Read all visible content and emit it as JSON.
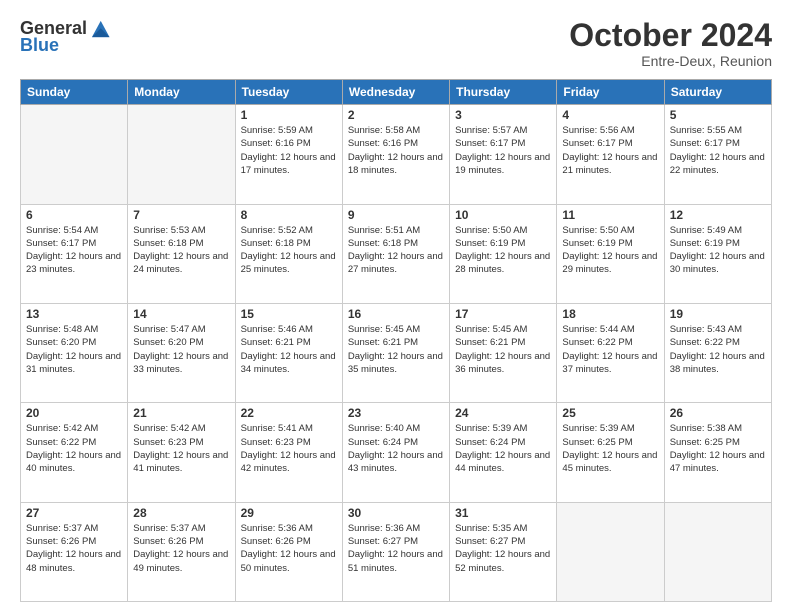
{
  "logo": {
    "line1": "General",
    "line2": "Blue"
  },
  "title": "October 2024",
  "location": "Entre-Deux, Reunion",
  "days_of_week": [
    "Sunday",
    "Monday",
    "Tuesday",
    "Wednesday",
    "Thursday",
    "Friday",
    "Saturday"
  ],
  "weeks": [
    [
      {
        "day": "",
        "info": ""
      },
      {
        "day": "",
        "info": ""
      },
      {
        "day": "1",
        "info": "Sunrise: 5:59 AM\nSunset: 6:16 PM\nDaylight: 12 hours and 17 minutes."
      },
      {
        "day": "2",
        "info": "Sunrise: 5:58 AM\nSunset: 6:16 PM\nDaylight: 12 hours and 18 minutes."
      },
      {
        "day": "3",
        "info": "Sunrise: 5:57 AM\nSunset: 6:17 PM\nDaylight: 12 hours and 19 minutes."
      },
      {
        "day": "4",
        "info": "Sunrise: 5:56 AM\nSunset: 6:17 PM\nDaylight: 12 hours and 21 minutes."
      },
      {
        "day": "5",
        "info": "Sunrise: 5:55 AM\nSunset: 6:17 PM\nDaylight: 12 hours and 22 minutes."
      }
    ],
    [
      {
        "day": "6",
        "info": "Sunrise: 5:54 AM\nSunset: 6:17 PM\nDaylight: 12 hours and 23 minutes."
      },
      {
        "day": "7",
        "info": "Sunrise: 5:53 AM\nSunset: 6:18 PM\nDaylight: 12 hours and 24 minutes."
      },
      {
        "day": "8",
        "info": "Sunrise: 5:52 AM\nSunset: 6:18 PM\nDaylight: 12 hours and 25 minutes."
      },
      {
        "day": "9",
        "info": "Sunrise: 5:51 AM\nSunset: 6:18 PM\nDaylight: 12 hours and 27 minutes."
      },
      {
        "day": "10",
        "info": "Sunrise: 5:50 AM\nSunset: 6:19 PM\nDaylight: 12 hours and 28 minutes."
      },
      {
        "day": "11",
        "info": "Sunrise: 5:50 AM\nSunset: 6:19 PM\nDaylight: 12 hours and 29 minutes."
      },
      {
        "day": "12",
        "info": "Sunrise: 5:49 AM\nSunset: 6:19 PM\nDaylight: 12 hours and 30 minutes."
      }
    ],
    [
      {
        "day": "13",
        "info": "Sunrise: 5:48 AM\nSunset: 6:20 PM\nDaylight: 12 hours and 31 minutes."
      },
      {
        "day": "14",
        "info": "Sunrise: 5:47 AM\nSunset: 6:20 PM\nDaylight: 12 hours and 33 minutes."
      },
      {
        "day": "15",
        "info": "Sunrise: 5:46 AM\nSunset: 6:21 PM\nDaylight: 12 hours and 34 minutes."
      },
      {
        "day": "16",
        "info": "Sunrise: 5:45 AM\nSunset: 6:21 PM\nDaylight: 12 hours and 35 minutes."
      },
      {
        "day": "17",
        "info": "Sunrise: 5:45 AM\nSunset: 6:21 PM\nDaylight: 12 hours and 36 minutes."
      },
      {
        "day": "18",
        "info": "Sunrise: 5:44 AM\nSunset: 6:22 PM\nDaylight: 12 hours and 37 minutes."
      },
      {
        "day": "19",
        "info": "Sunrise: 5:43 AM\nSunset: 6:22 PM\nDaylight: 12 hours and 38 minutes."
      }
    ],
    [
      {
        "day": "20",
        "info": "Sunrise: 5:42 AM\nSunset: 6:22 PM\nDaylight: 12 hours and 40 minutes."
      },
      {
        "day": "21",
        "info": "Sunrise: 5:42 AM\nSunset: 6:23 PM\nDaylight: 12 hours and 41 minutes."
      },
      {
        "day": "22",
        "info": "Sunrise: 5:41 AM\nSunset: 6:23 PM\nDaylight: 12 hours and 42 minutes."
      },
      {
        "day": "23",
        "info": "Sunrise: 5:40 AM\nSunset: 6:24 PM\nDaylight: 12 hours and 43 minutes."
      },
      {
        "day": "24",
        "info": "Sunrise: 5:39 AM\nSunset: 6:24 PM\nDaylight: 12 hours and 44 minutes."
      },
      {
        "day": "25",
        "info": "Sunrise: 5:39 AM\nSunset: 6:25 PM\nDaylight: 12 hours and 45 minutes."
      },
      {
        "day": "26",
        "info": "Sunrise: 5:38 AM\nSunset: 6:25 PM\nDaylight: 12 hours and 47 minutes."
      }
    ],
    [
      {
        "day": "27",
        "info": "Sunrise: 5:37 AM\nSunset: 6:26 PM\nDaylight: 12 hours and 48 minutes."
      },
      {
        "day": "28",
        "info": "Sunrise: 5:37 AM\nSunset: 6:26 PM\nDaylight: 12 hours and 49 minutes."
      },
      {
        "day": "29",
        "info": "Sunrise: 5:36 AM\nSunset: 6:26 PM\nDaylight: 12 hours and 50 minutes."
      },
      {
        "day": "30",
        "info": "Sunrise: 5:36 AM\nSunset: 6:27 PM\nDaylight: 12 hours and 51 minutes."
      },
      {
        "day": "31",
        "info": "Sunrise: 5:35 AM\nSunset: 6:27 PM\nDaylight: 12 hours and 52 minutes."
      },
      {
        "day": "",
        "info": ""
      },
      {
        "day": "",
        "info": ""
      }
    ]
  ]
}
